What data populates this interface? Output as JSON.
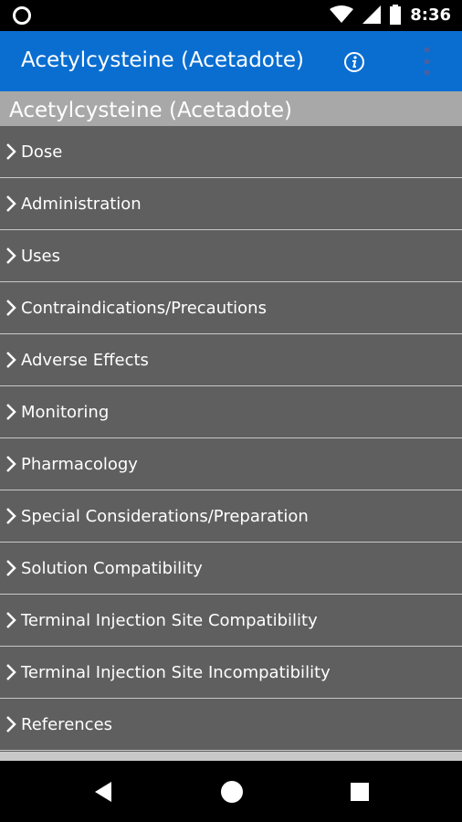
{
  "status_bar": {
    "time": "8:36",
    "icons": [
      "circle-notification-icon",
      "wifi-icon",
      "signal-icon",
      "battery-icon"
    ]
  },
  "app_bar": {
    "title": "Acetylcysteine (Acetadote)",
    "actions": [
      "info-icon",
      "overflow-menu-icon"
    ],
    "color": "#0a6ed1"
  },
  "section": {
    "header": "Acetylcysteine (Acetadote)"
  },
  "menu": {
    "items": [
      {
        "label": "Dose"
      },
      {
        "label": "Administration"
      },
      {
        "label": "Uses"
      },
      {
        "label": "Contraindications/Precautions"
      },
      {
        "label": "Adverse Effects"
      },
      {
        "label": "Monitoring"
      },
      {
        "label": "Pharmacology"
      },
      {
        "label": "Special Considerations/Preparation"
      },
      {
        "label": "Solution Compatibility"
      },
      {
        "label": "Terminal Injection Site Compatibility"
      },
      {
        "label": "Terminal Injection Site Incompatibility"
      },
      {
        "label": "References"
      }
    ]
  },
  "nav_bar": {
    "buttons": [
      "back-icon",
      "home-icon",
      "recents-icon"
    ]
  }
}
